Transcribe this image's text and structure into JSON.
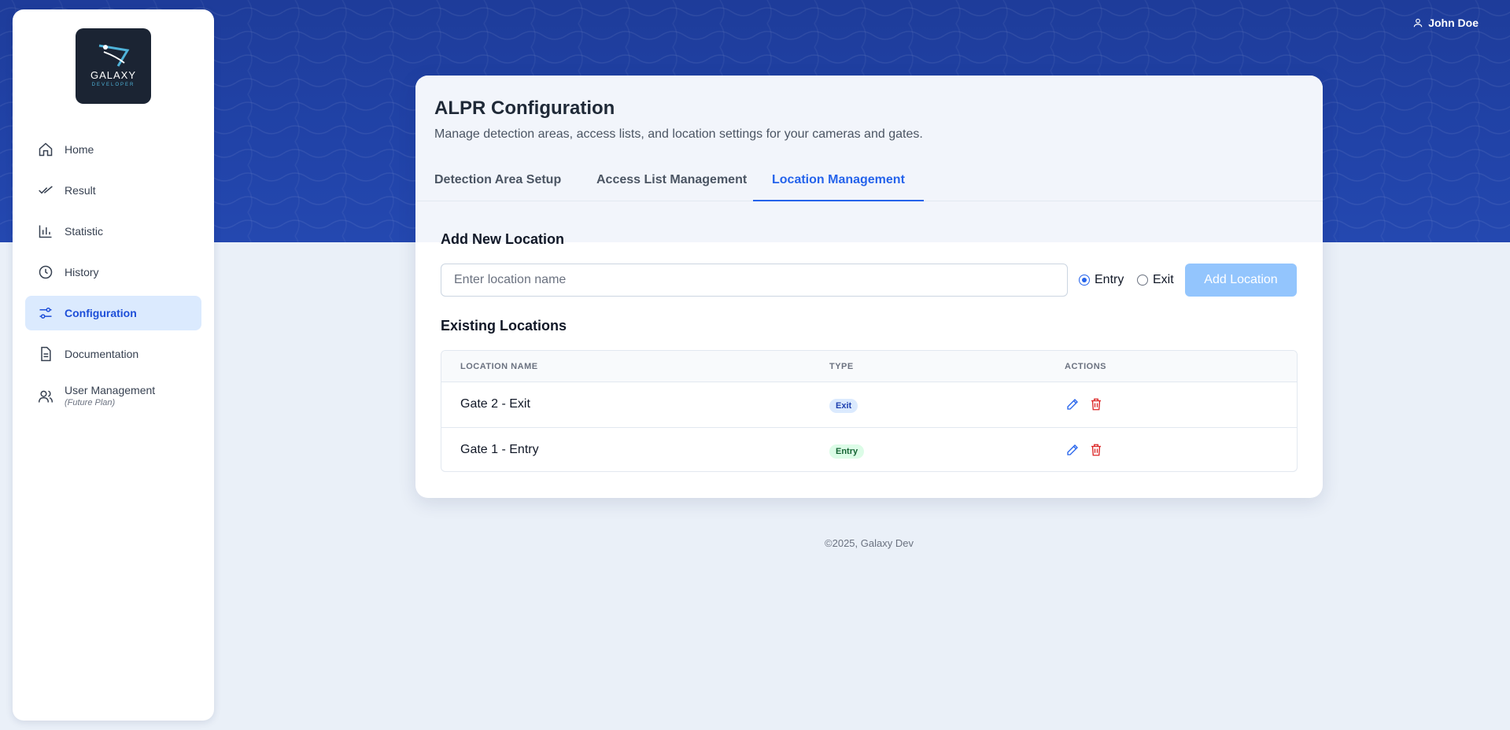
{
  "user": {
    "name": "John Doe",
    "icon": "user-icon"
  },
  "brand": {
    "name": "GALAXY",
    "tagline": "DEVELOPER"
  },
  "sidebar": {
    "items": [
      {
        "label": "Home",
        "icon": "home-icon"
      },
      {
        "label": "Result",
        "icon": "check-double-icon"
      },
      {
        "label": "Statistic",
        "icon": "bar-chart-icon"
      },
      {
        "label": "History",
        "icon": "clock-icon"
      },
      {
        "label": "Configuration",
        "icon": "sliders-icon",
        "active": true
      },
      {
        "label": "Documentation",
        "icon": "document-icon"
      },
      {
        "label": "User Management",
        "sublabel": "(Future Plan)",
        "icon": "users-icon"
      }
    ]
  },
  "page": {
    "title": "ALPR Configuration",
    "subtitle": "Manage detection areas, access lists, and location settings for your cameras and gates.",
    "tabs": [
      {
        "label": "Detection Area Setup"
      },
      {
        "label": "Access List Management"
      },
      {
        "label": "Location Management",
        "active": true
      }
    ]
  },
  "add_location": {
    "title": "Add New Location",
    "placeholder": "Enter location name",
    "value": "",
    "radio_entry": "Entry",
    "radio_exit": "Exit",
    "selected": "Entry",
    "button": "Add Location"
  },
  "existing": {
    "title": "Existing Locations",
    "columns": [
      "LOCATION NAME",
      "TYPE",
      "ACTIONS"
    ],
    "rows": [
      {
        "name": "Gate 2 - Exit",
        "type": "Exit"
      },
      {
        "name": "Gate 1 - Entry",
        "type": "Entry"
      }
    ]
  },
  "footer": {
    "text": "©2025, Galaxy Dev"
  },
  "colors": {
    "accent": "#2563eb",
    "hero": "#1e3c9a",
    "delete": "#dc2626",
    "entry_badge": "#dcfce7",
    "exit_badge": "#dbeafe"
  }
}
